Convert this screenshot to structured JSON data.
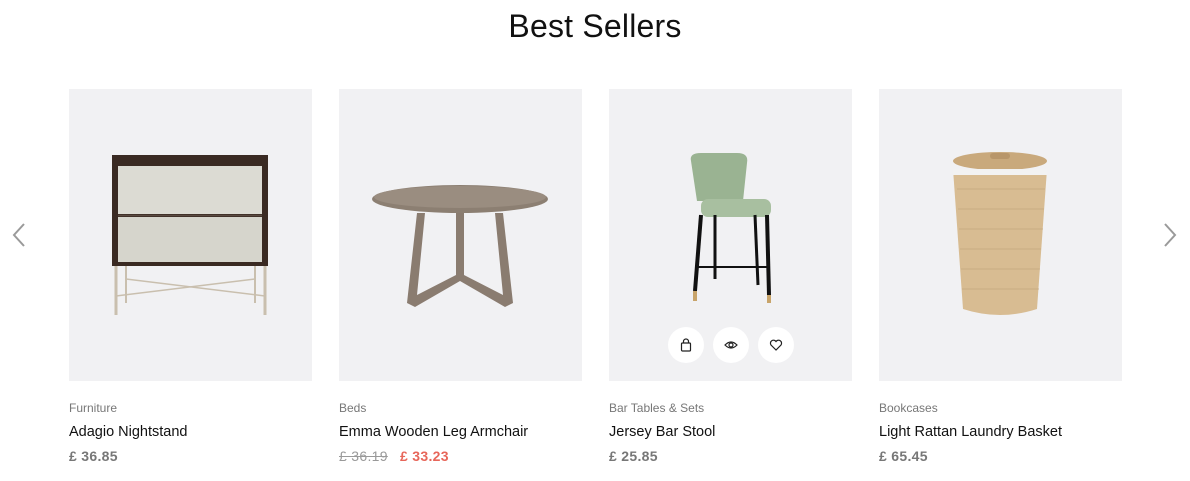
{
  "section": {
    "title": "Best Sellers"
  },
  "nav": {
    "prev_icon": "chevron-left-icon",
    "next_icon": "chevron-right-icon"
  },
  "products": [
    {
      "category": "Furniture",
      "name": "Adagio Nightstand",
      "price": "£ 36.85"
    },
    {
      "category": "Beds",
      "name": "Emma Wooden Leg Armchair",
      "old_price": "£ 36.19",
      "price": "£ 33.23"
    },
    {
      "category": "Bar Tables & Sets",
      "name": "Jersey Bar Stool",
      "price": "£ 25.85",
      "actions": [
        "bag-icon",
        "eye-icon",
        "heart-icon"
      ]
    },
    {
      "category": "Bookcases",
      "name": "Light Rattan Laundry Basket",
      "price": "£ 65.45"
    }
  ],
  "colors": {
    "sale": "#e7665a",
    "card_bg": "#f1f1f3"
  }
}
